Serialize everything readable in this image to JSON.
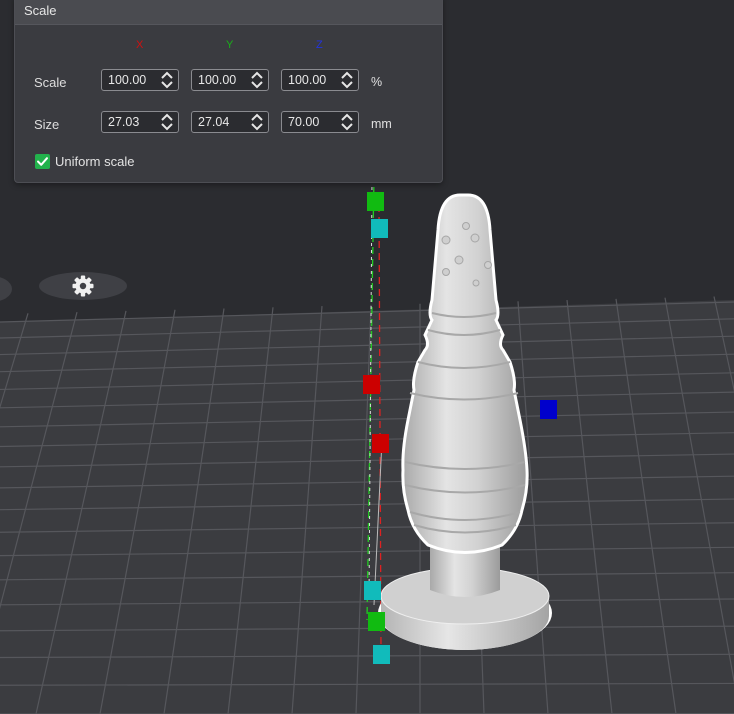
{
  "panel": {
    "title": "Scale",
    "axes": {
      "x": "X",
      "y": "Y",
      "z": "Z"
    },
    "scale_row": {
      "label": "Scale",
      "x": "100.00",
      "y": "100.00",
      "z": "100.00",
      "unit": "%"
    },
    "size_row": {
      "label": "Size",
      "x": "27.03",
      "y": "27.04",
      "z": "70.00",
      "unit": "mm"
    },
    "uniform": {
      "label": "Uniform scale",
      "checked": true
    }
  },
  "colors": {
    "background": "#2b2c30",
    "panel": "#3a3b40",
    "grid_floor": "#3b3c40",
    "grid_line": "#56575c",
    "handle_red": "#cc0000",
    "handle_green": "#11bb11",
    "handle_cyan": "#11bbbb",
    "handle_blue": "#0000cc",
    "checkbox": "#22b24c",
    "model": "#d6d6d6"
  },
  "icons": {
    "gear": "gear-icon",
    "spin": "spin-arrows-icon",
    "check": "checkmark-icon"
  }
}
